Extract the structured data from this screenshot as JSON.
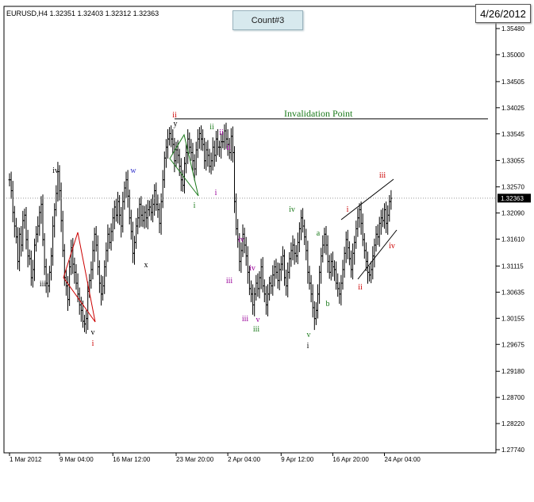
{
  "header": {
    "symbol_line": "EURUSD,H4  1.32351  1.32403  1.32312  1.32363",
    "count_label": "Count#3",
    "date_label": "4/26/2012"
  },
  "colors": {
    "bars": "#000000",
    "green_waves": "#1a7a1a",
    "red_waves": "#cc0000",
    "purple_waves": "#990099",
    "blue_waves": "#3333cc",
    "wedge_lines": "#000000",
    "current_price_line": "#999999",
    "current_price_tag_bg": "#000000",
    "current_price_tag_text": "#ffffff"
  },
  "chart_data": {
    "type": "ohlc",
    "symbol": "EURUSD",
    "timeframe": "H4",
    "ylim": [
      1.2774,
      1.3583
    ],
    "y_ticks": [
      1.3548,
      1.35,
      1.34505,
      1.34025,
      1.33545,
      1.33055,
      1.3257,
      1.3209,
      1.3161,
      1.31115,
      1.30635,
      1.30155,
      1.29675,
      1.2918,
      1.287,
      1.2822,
      1.2774
    ],
    "y_tick_labels": [
      "1.35480",
      "1.35000",
      "1.34505",
      "1.34025",
      "1.33545",
      "1.33055",
      "1.32570",
      "1.32090",
      "1.31610",
      "1.31115",
      "1.30635",
      "1.30155",
      "1.29675",
      "1.29180",
      "1.28700",
      "1.28220",
      "1.27740"
    ],
    "x_tick_labels": [
      "1 Mar 2012",
      "9 Mar 04:00",
      "16 Mar 12:00",
      "23 Mar 20:00",
      "2 Apr 04:00",
      "9 Apr 12:00",
      "16 Apr 20:00",
      "24 Apr 04:00"
    ],
    "x_tick_bar_index": [
      0,
      30,
      62,
      100,
      131,
      163,
      194,
      225
    ],
    "current_price": 1.32363,
    "current_price_label": "1.32363",
    "invalidation_level": 1.3382,
    "invalidation_label": "Invalidation Point",
    "closes": [
      1.327,
      1.325,
      1.321,
      1.3185,
      1.3165,
      1.312,
      1.317,
      1.315,
      1.3195,
      1.3205,
      1.316,
      1.313,
      1.3125,
      1.309,
      1.3105,
      1.315,
      1.317,
      1.3185,
      1.321,
      1.3225,
      1.316,
      1.311,
      1.308,
      1.3075,
      1.31,
      1.313,
      1.3185,
      1.3215,
      1.3245,
      1.3285,
      1.325,
      1.3195,
      1.314,
      1.309,
      1.3075,
      1.305,
      1.311,
      1.3145,
      1.3115,
      1.31,
      1.308,
      1.306,
      1.304,
      1.303,
      1.301,
      1.3005,
      1.3015,
      1.3065,
      1.3085,
      1.3105,
      1.314,
      1.317,
      1.315,
      1.311,
      1.308,
      1.306,
      1.3075,
      1.311,
      1.314,
      1.317,
      1.3155,
      1.3175,
      1.32,
      1.322,
      1.3205,
      1.323,
      1.3205,
      1.3185,
      1.323,
      1.3255,
      1.327,
      1.324,
      1.32,
      1.3175,
      1.3135,
      1.3155,
      1.3185,
      1.32,
      1.3225,
      1.3205,
      1.3195,
      1.321,
      1.32,
      1.3215,
      1.322,
      1.321,
      1.3225,
      1.325,
      1.3225,
      1.3215,
      1.319,
      1.323,
      1.327,
      1.331,
      1.333,
      1.3345,
      1.3355,
      1.3345,
      1.3335,
      1.3305,
      1.3325,
      1.3315,
      1.3295,
      1.327,
      1.326,
      1.33,
      1.332,
      1.3345,
      1.333,
      1.332,
      1.3305,
      1.329,
      1.3325,
      1.3345,
      1.3355,
      1.3345,
      1.3335,
      1.3305,
      1.3325,
      1.3315,
      1.3295,
      1.3305,
      1.333,
      1.3315,
      1.3345,
      1.333,
      1.333,
      1.334,
      1.334,
      1.336,
      1.3345,
      1.3335,
      1.332,
      1.335,
      1.332,
      1.323,
      1.318,
      1.316,
      1.312,
      1.314,
      1.317,
      1.315,
      1.313,
      1.31,
      1.307,
      1.306,
      1.304,
      1.306,
      1.308,
      1.307,
      1.309,
      1.311,
      1.3075,
      1.306,
      1.304,
      1.306,
      1.308,
      1.3075,
      1.3095,
      1.311,
      1.31,
      1.3085,
      1.3105,
      1.3115,
      1.313,
      1.309,
      1.3075,
      1.31,
      1.3125,
      1.314,
      1.315,
      1.3135,
      1.313,
      1.3155,
      1.318,
      1.32,
      1.3185,
      1.3165,
      1.314,
      1.31,
      1.308,
      1.306,
      1.3035,
      1.3015,
      1.303,
      1.306,
      1.31,
      1.313,
      1.315,
      1.317,
      1.315,
      1.312,
      1.31,
      1.312,
      1.311,
      1.3105,
      1.308,
      1.307,
      1.306,
      1.308,
      1.3105,
      1.3135,
      1.316,
      1.3145,
      1.3125,
      1.3105,
      1.3135,
      1.3155,
      1.318,
      1.32,
      1.3215,
      1.319,
      1.316,
      1.314,
      1.312,
      1.31,
      1.3095,
      1.3105,
      1.313,
      1.315,
      1.317,
      1.3165,
      1.319,
      1.32,
      1.3195,
      1.3215,
      1.319,
      1.3205,
      1.323,
      1.3236
    ],
    "wave_labels": [
      {
        "text": "iv",
        "bar": 10,
        "price": 1.3298,
        "color": "#000000",
        "pos": "above"
      },
      {
        "text": "iii",
        "bar": 7,
        "price": 1.3099,
        "color": "#000000",
        "pos": "below"
      },
      {
        "text": "w",
        "bar": 26,
        "price": 1.3298,
        "color": "#3333cc",
        "pos": "above"
      },
      {
        "text": "v",
        "bar": 17,
        "price": 1.3,
        "color": "#000000",
        "pos": "below"
      },
      {
        "text": "i",
        "bar": 17,
        "price": 1.2978,
        "color": "#cc0000",
        "pos": "below"
      },
      {
        "text": "x",
        "bar": 28,
        "price": 1.3137,
        "color": "#000000",
        "pos": "below"
      },
      {
        "text": "ii",
        "bar": 33,
        "price": 1.3386,
        "color": "#cc0000",
        "pos": "above"
      },
      {
        "text": "y",
        "bar": 33,
        "price": 1.3366,
        "color": "#000000",
        "pos": "above"
      },
      {
        "text": "i",
        "bar": 37,
        "price": 1.3235,
        "color": "#1a7a1a",
        "pos": "below"
      },
      {
        "text": "ii",
        "bar": 40,
        "price": 1.3374,
        "color": "#1a7a1a",
        "pos": "above"
      },
      {
        "text": "ii",
        "bar": 42,
        "price": 1.3363,
        "color": "#990099",
        "pos": "above"
      },
      {
        "text": "ii",
        "bar": 43,
        "price": 1.3335,
        "color": "#990099",
        "pos": "right"
      },
      {
        "text": "i",
        "bar": 41,
        "price": 1.3258,
        "color": "#990099",
        "pos": "below"
      },
      {
        "text": "iv",
        "bar": 45,
        "price": 1.3179,
        "color": "#990099",
        "pos": "above"
      },
      {
        "text": "iii",
        "bar": 43,
        "price": 1.31,
        "color": "#990099",
        "pos": "below"
      },
      {
        "text": "iv",
        "bar": 48,
        "price": 1.3124,
        "color": "#990099",
        "pos": "above"
      },
      {
        "text": "iii",
        "bar": 46,
        "price": 1.3027,
        "color": "#990099",
        "pos": "below"
      },
      {
        "text": "v",
        "bar": 49,
        "price": 1.3031,
        "color": "#990099",
        "pos": "below"
      },
      {
        "text": "iii",
        "bar": 49,
        "price": 1.3008,
        "color": "#1a7a1a",
        "pos": "below"
      },
      {
        "text": "iv",
        "bar": 55,
        "price": 1.323,
        "color": "#1a7a1a",
        "pos": "above"
      },
      {
        "text": "v",
        "bar": 58,
        "price": 1.2993,
        "color": "#1a7a1a",
        "pos": "below"
      },
      {
        "text": "i",
        "bar": 58,
        "price": 1.2967,
        "color": "#000000",
        "pos": "below"
      },
      {
        "text": "a",
        "bar": 60,
        "price": 1.3184,
        "color": "#1a7a1a",
        "pos": "above"
      },
      {
        "text": "b",
        "bar": 62,
        "price": 1.3047,
        "color": "#1a7a1a",
        "pos": "below"
      },
      {
        "text": "i",
        "bar": 66,
        "price": 1.3229,
        "color": "#cc0000",
        "pos": "above"
      },
      {
        "text": "iii",
        "bar": 72,
        "price": 1.3285,
        "color": "#cc0000",
        "pos": "above"
      },
      {
        "text": "ii",
        "bar": 68,
        "price": 1.3083,
        "color": "#cc0000",
        "pos": "below"
      },
      {
        "text": "iv",
        "bar": 74,
        "price": 1.317,
        "color": "#cc0000",
        "pos": "right"
      }
    ]
  }
}
